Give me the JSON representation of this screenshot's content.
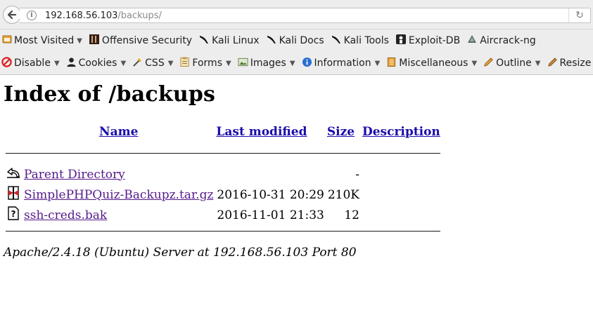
{
  "browser": {
    "url_host": "192.168.56.103",
    "url_path": "/backups/"
  },
  "bookmarks": [
    {
      "label": "Most Visited",
      "icon": "most-visited-icon",
      "dropdown": true
    },
    {
      "label": "Offensive Security",
      "icon": "offsec-icon",
      "dropdown": false
    },
    {
      "label": "Kali Linux",
      "icon": "kali-dragon-icon",
      "dropdown": false
    },
    {
      "label": "Kali Docs",
      "icon": "kali-dragon-icon",
      "dropdown": false
    },
    {
      "label": "Kali Tools",
      "icon": "kali-dragon-icon",
      "dropdown": false
    },
    {
      "label": "Exploit-DB",
      "icon": "exploitdb-icon",
      "dropdown": false
    },
    {
      "label": "Aircrack-ng",
      "icon": "aircrack-icon",
      "dropdown": false
    }
  ],
  "devtools": [
    {
      "label": "Disable",
      "icon": "disable-icon"
    },
    {
      "label": "Cookies",
      "icon": "cookies-icon"
    },
    {
      "label": "CSS",
      "icon": "css-icon"
    },
    {
      "label": "Forms",
      "icon": "forms-icon"
    },
    {
      "label": "Images",
      "icon": "images-icon"
    },
    {
      "label": "Information",
      "icon": "information-icon"
    },
    {
      "label": "Miscellaneous",
      "icon": "miscellaneous-icon"
    },
    {
      "label": "Outline",
      "icon": "outline-icon"
    },
    {
      "label": "Resize",
      "icon": "resize-icon"
    }
  ],
  "page": {
    "title": "Index of /backups",
    "columns": {
      "name": "Name",
      "modified": "Last modified",
      "size": "Size",
      "description": "Description"
    },
    "rows": [
      {
        "icon": "parent-directory-icon",
        "name": "Parent Directory",
        "modified": "",
        "size": "-",
        "description": ""
      },
      {
        "icon": "compressed-file-icon",
        "name": "SimplePHPQuiz-Backupz.tar.gz",
        "modified": "2016-10-31 20:29",
        "size": "210K",
        "description": ""
      },
      {
        "icon": "unknown-file-icon",
        "name": "ssh-creds.bak",
        "modified": "2016-11-01 21:33",
        "size": "12",
        "description": ""
      }
    ],
    "footer": "Apache/2.4.18 (Ubuntu) Server at 192.168.56.103 Port 80"
  }
}
